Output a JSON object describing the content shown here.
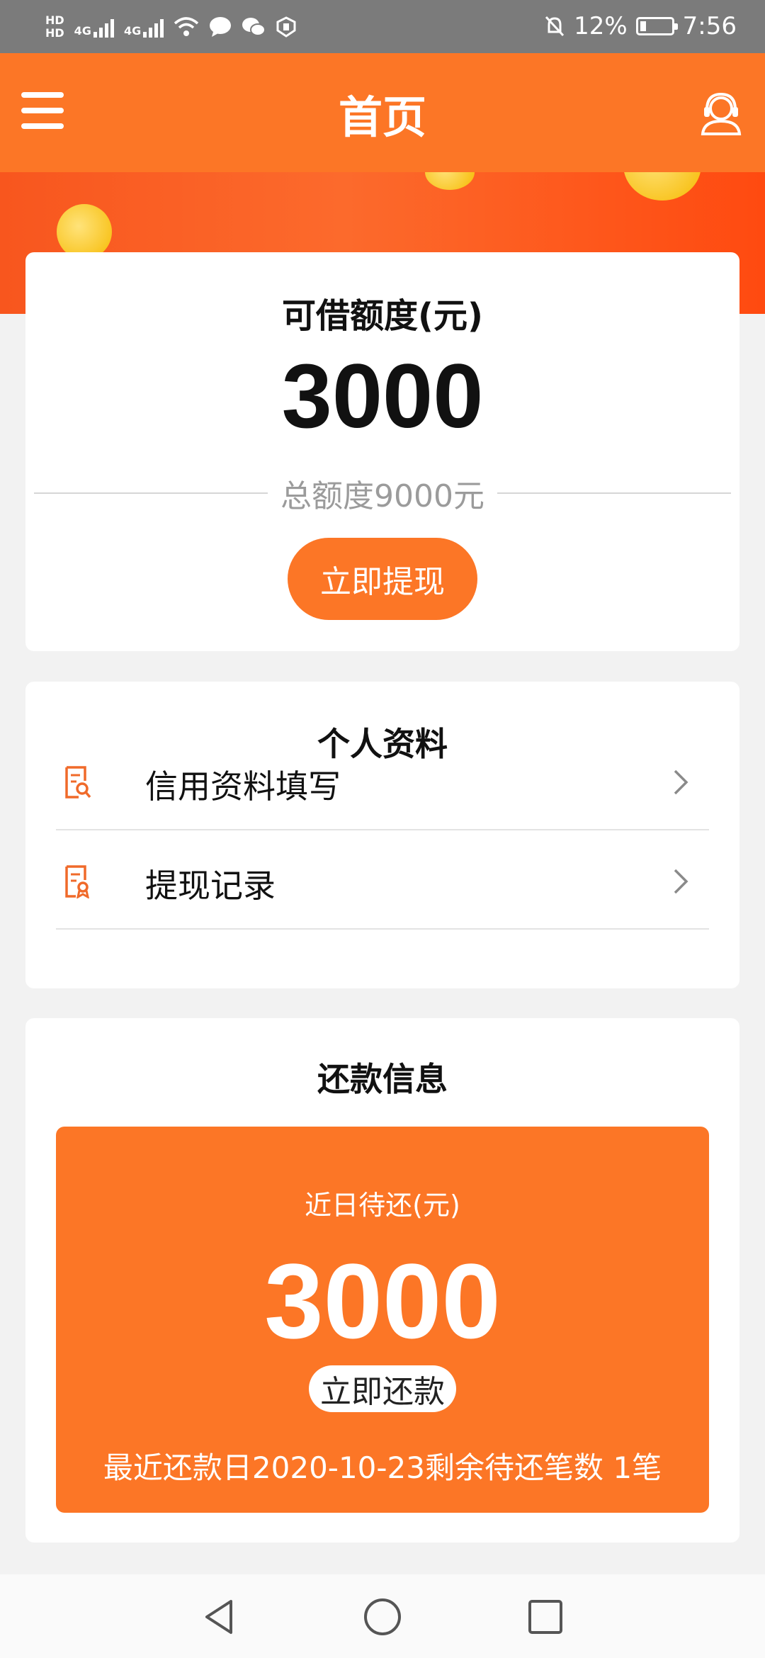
{
  "status_bar": {
    "hd1": "HD",
    "hd2": "HD",
    "net1": "4G",
    "net2": "4G",
    "battery": "12%",
    "time": "7:56"
  },
  "app_bar": {
    "title": "首页",
    "menu_icon": "hamburger-menu-icon",
    "support_icon": "customer-service-icon"
  },
  "credit": {
    "label": "可借额度(元)",
    "amount": "3000",
    "total": "总额度9000元",
    "withdraw_button": "立即提现"
  },
  "profile": {
    "title": "个人资料",
    "items": [
      {
        "label": "信用资料填写",
        "icon": "document-search-icon"
      },
      {
        "label": "提现记录",
        "icon": "document-record-icon"
      }
    ]
  },
  "repayment": {
    "title": "还款信息",
    "label": "近日待还(元)",
    "amount": "3000",
    "button": "立即还款",
    "footer": "最近还款日2020-10-23剩余待还笔数 1笔"
  },
  "colors": {
    "accent": "#fc7626",
    "status_bar": "#7b7b7b",
    "background": "#f2f2f2"
  }
}
